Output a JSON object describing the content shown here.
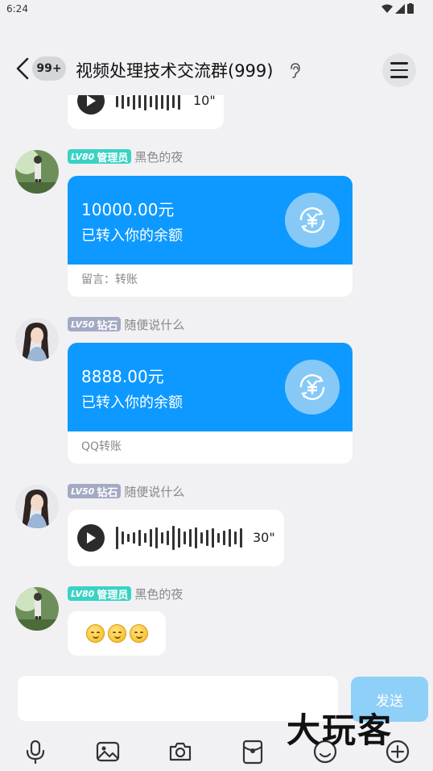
{
  "status_bar": {
    "time": "6:24"
  },
  "header": {
    "unread_badge": "99+",
    "title": "视频处理技术交流群(999)"
  },
  "messages": [
    {
      "type": "voice",
      "duration": "10\""
    },
    {
      "type": "transfer",
      "level": "LV80",
      "role": "管理员",
      "nickname": "黑色的夜",
      "amount": "10000.00元",
      "status": "已转入你的余额",
      "note": "留言：转账"
    },
    {
      "type": "transfer",
      "level": "LV50",
      "role": "钻石",
      "nickname": "随便说什么",
      "amount": "8888.00元",
      "status": "已转入你的余额",
      "note": "QQ转账"
    },
    {
      "type": "voice",
      "level": "LV50",
      "role": "钻石",
      "nickname": "随便说什么",
      "duration": "30\""
    },
    {
      "type": "emoji",
      "level": "LV80",
      "role": "管理员",
      "nickname": "黑色的夜"
    }
  ],
  "input": {
    "value": "",
    "send_label": "发送"
  },
  "toolbar": [
    "microphone-icon",
    "image-icon",
    "camera-icon",
    "red-packet-icon",
    "emoji-icon",
    "plus-icon"
  ],
  "watermark": "大玩客",
  "colors": {
    "accent": "#0d99ff",
    "admin_badge": "#39d2c4",
    "diamond_badge": "#a4a9c4",
    "send_button": "#8ed0f8"
  }
}
